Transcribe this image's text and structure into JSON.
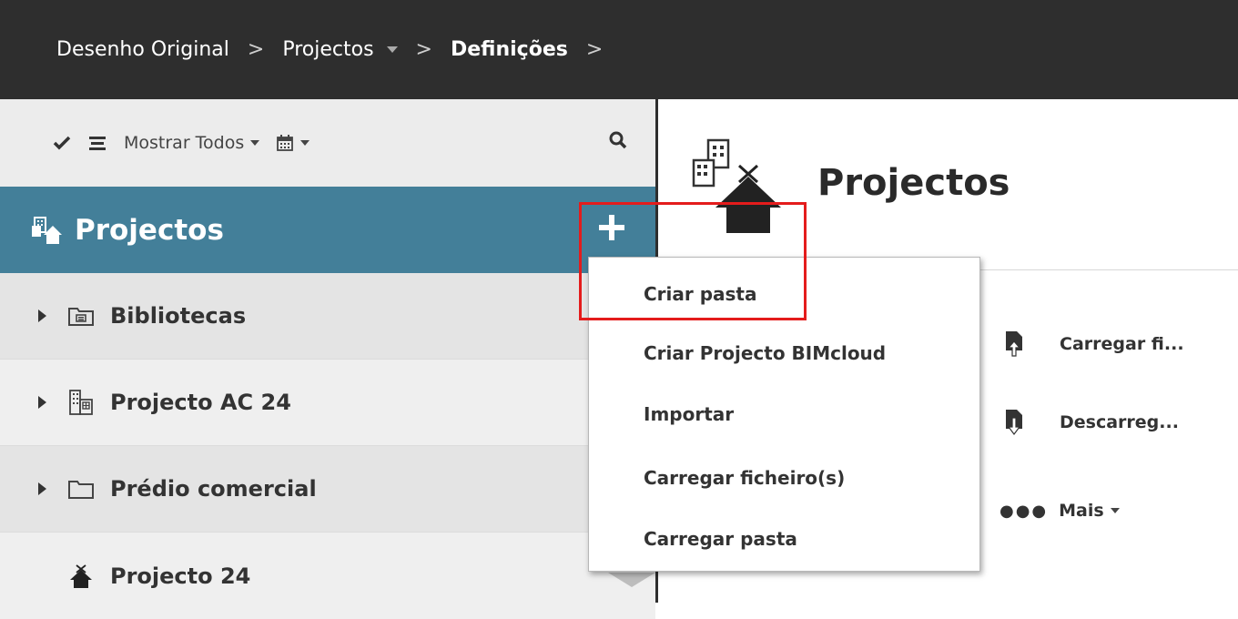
{
  "breadcrumb": {
    "items": [
      {
        "label": "Desenho Original"
      },
      {
        "label": "Projectos"
      },
      {
        "label": "Definições"
      }
    ]
  },
  "sidebar": {
    "toolbar": {
      "filter_label": "Mostrar Todos"
    },
    "header_title": "Projectos",
    "items": [
      {
        "label": "Bibliotecas",
        "icon": "library-folder-icon"
      },
      {
        "label": "Projecto AC 24",
        "icon": "building-icon"
      },
      {
        "label": "Prédio comercial",
        "icon": "folder-icon"
      },
      {
        "label": "Projecto 24",
        "icon": "project-house-icon"
      }
    ]
  },
  "main": {
    "title": "Projectos",
    "actions": [
      {
        "label": "Carregar fi..."
      },
      {
        "label": "Descarreg..."
      }
    ],
    "more_label": "Mais"
  },
  "menu": {
    "items": [
      {
        "label": "Criar pasta"
      },
      {
        "label": "Criar Projecto BIMcloud"
      },
      {
        "label": "Importar"
      },
      {
        "label": "Carregar ficheiro(s)"
      },
      {
        "label": "Carregar pasta"
      }
    ]
  },
  "colors": {
    "topbar": "#2e2e2e",
    "header": "#437f99",
    "highlight": "#e41c1c"
  }
}
